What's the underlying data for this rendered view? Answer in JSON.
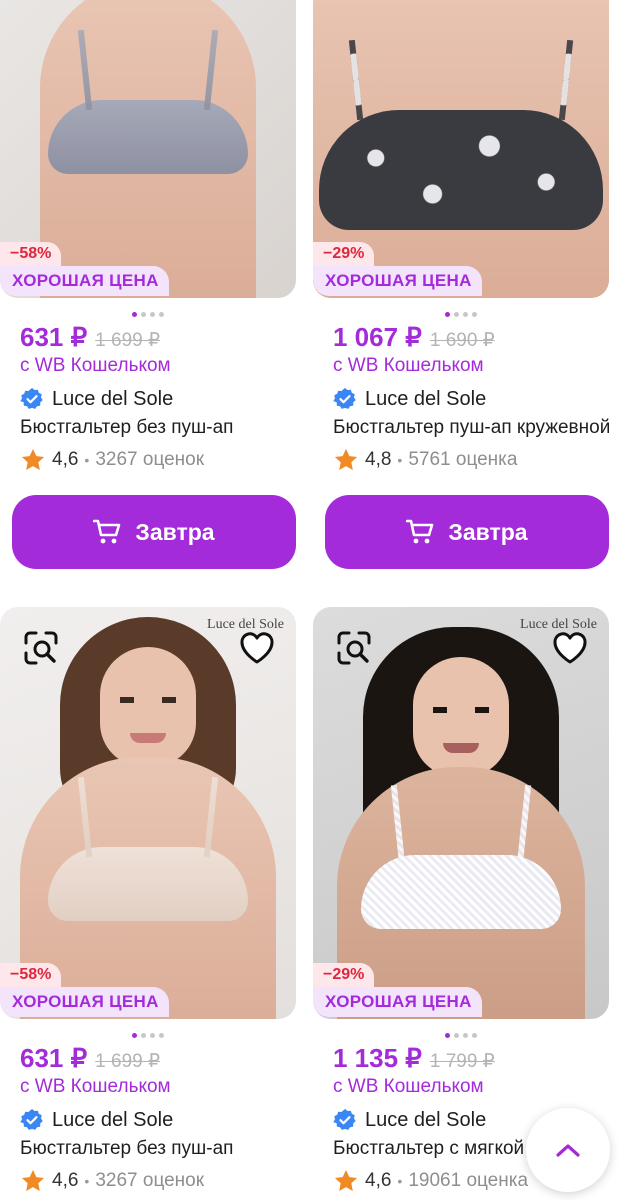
{
  "products": [
    {
      "discount": "−58%",
      "good_price": "ХОРОШАЯ ЦЕНА",
      "price": "631 ₽",
      "old_price": "1 699 ₽",
      "wallet": "с WB Кошельком",
      "brand": "Luce del Sole",
      "title": "Бюстгальтер без пуш-ап",
      "rating": "4,6",
      "reviews": "3267 оценок",
      "button": "Завтра"
    },
    {
      "discount": "−29%",
      "good_price": "ХОРОШАЯ ЦЕНА",
      "price": "1 067 ₽",
      "old_price": "1 690 ₽",
      "wallet": "с WB Кошельком",
      "brand": "Luce del Sole",
      "title": "Бюстгальтер пуш-ап кружевной",
      "rating": "4,8",
      "reviews": "5761 оценка",
      "button": "Завтра"
    },
    {
      "watermark": "Luce del Sole",
      "discount": "−58%",
      "good_price": "ХОРОШАЯ ЦЕНА",
      "price": "631 ₽",
      "old_price": "1 699 ₽",
      "wallet": "с WB Кошельком",
      "brand": "Luce del Sole",
      "title": "Бюстгальтер без пуш-ап",
      "rating": "4,6",
      "reviews": "3267 оценок"
    },
    {
      "watermark": "Luce del Sole",
      "discount": "−29%",
      "good_price": "ХОРОШАЯ ЦЕНА",
      "price": "1 135 ₽",
      "old_price": "1 799 ₽",
      "wallet": "с WB Кошельком",
      "brand": "Luce del Sole",
      "title": "Бюстгальтер с мягкой чашкой",
      "rating": "4,6",
      "reviews": "19061 оценка"
    }
  ],
  "icons": {
    "search_similar": "image-search-icon",
    "favorite": "heart-icon",
    "cart": "cart-icon",
    "verified": "verified-check-icon",
    "star": "star-icon",
    "scroll_top": "chevron-up-icon"
  },
  "colors": {
    "accent": "#a32bd9",
    "discount": "#e0263c",
    "star": "#f08a24",
    "verified": "#3b86f5"
  }
}
